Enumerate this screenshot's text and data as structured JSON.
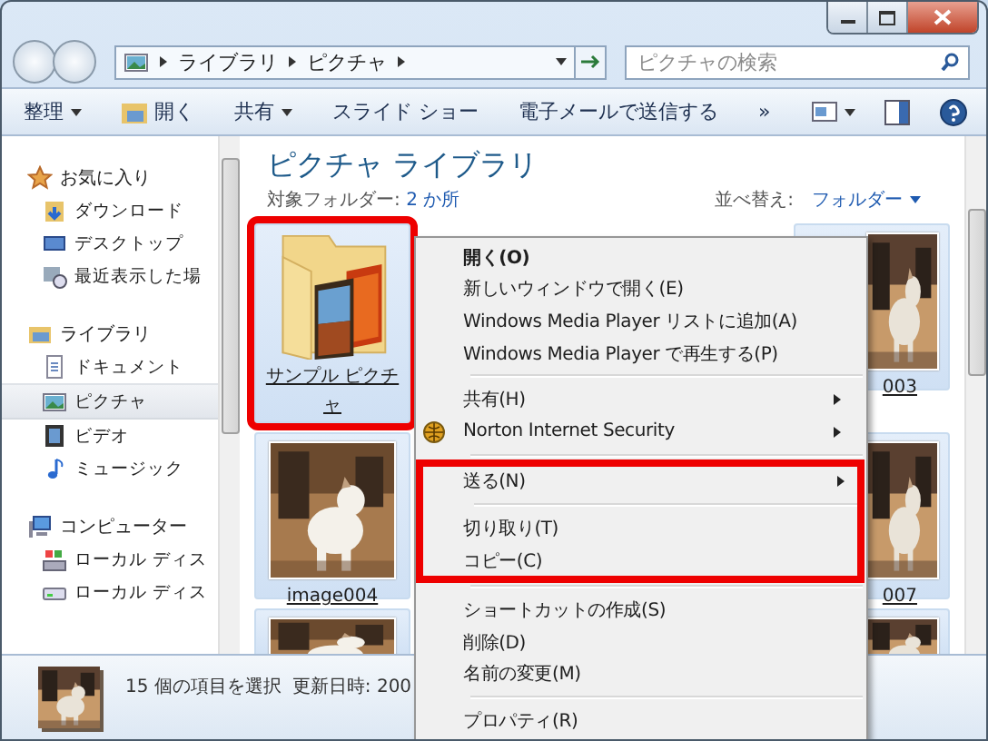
{
  "address_bar": {
    "crumbs": [
      "ライブラリ",
      "ピクチャ"
    ]
  },
  "search": {
    "placeholder": "ピクチャの検索"
  },
  "toolbar": {
    "buttons": [
      {
        "label": "整理",
        "kind": "menu"
      },
      {
        "label": "開く",
        "kind": "open"
      },
      {
        "label": "共有",
        "kind": "menu"
      },
      {
        "label": "スライド ショー",
        "kind": "plain"
      },
      {
        "label": "電子メールで送信する",
        "kind": "plain"
      },
      {
        "label": "»",
        "kind": "plain"
      }
    ]
  },
  "sidebar": {
    "groups": [
      {
        "label": "お気に入り",
        "kind": "star",
        "items": [
          {
            "label": "ダウンロード",
            "kind": "download",
            "selected": false
          },
          {
            "label": "デスクトップ",
            "kind": "desktop",
            "selected": false
          },
          {
            "label": "最近表示した場",
            "kind": "recent",
            "selected": false
          }
        ]
      },
      {
        "label": "ライブラリ",
        "kind": "library",
        "items": [
          {
            "label": "ドキュメント",
            "kind": "document",
            "selected": false
          },
          {
            "label": "ピクチャ",
            "kind": "pictures",
            "selected": true
          },
          {
            "label": "ビデオ",
            "kind": "video",
            "selected": false
          },
          {
            "label": "ミュージック",
            "kind": "music",
            "selected": false
          }
        ]
      },
      {
        "label": "コンピューター",
        "kind": "computer",
        "items": [
          {
            "label": "ローカル ディス",
            "kind": "system-disk",
            "selected": false
          },
          {
            "label": "ローカル ディス",
            "kind": "disk",
            "selected": false
          }
        ]
      }
    ]
  },
  "library": {
    "title": "ピクチャ ライブラリ",
    "folders_label": "対象フォルダー:",
    "folders_link": "2 か所",
    "sort_label": "並べ替え:",
    "sort_value": "フォルダー"
  },
  "items": [
    {
      "kind": "folder",
      "label": "サンプル ピクチャ",
      "selected": true,
      "highlighted": true
    },
    {
      "kind": "picture",
      "label": "003",
      "selected": true,
      "highlighted": false
    },
    {
      "kind": "picture",
      "label": "image004",
      "selected": true,
      "highlighted": false
    },
    {
      "kind": "picture",
      "label": "007",
      "selected": true,
      "highlighted": false
    },
    {
      "kind": "picture",
      "selected": true,
      "highlighted": false
    },
    {
      "kind": "picture",
      "selected": true,
      "highlighted": false
    }
  ],
  "context_menu": [
    {
      "kind": "item",
      "label": "開く(O)",
      "default": true,
      "submenu": false,
      "highlighted": false
    },
    {
      "kind": "item",
      "label": "新しいウィンドウで開く(E)",
      "default": false,
      "submenu": false,
      "highlighted": false
    },
    {
      "kind": "item",
      "label": "Windows Media Player リストに追加(A)",
      "default": false,
      "submenu": false,
      "highlighted": false
    },
    {
      "kind": "item",
      "label": "Windows Media Player で再生する(P)",
      "default": false,
      "submenu": false,
      "highlighted": false
    },
    {
      "kind": "separator"
    },
    {
      "kind": "item",
      "label": "共有(H)",
      "default": false,
      "submenu": true,
      "highlighted": false
    },
    {
      "kind": "norton",
      "label": "Norton Internet Security",
      "default": false,
      "submenu": true,
      "highlighted": false
    },
    {
      "kind": "separator"
    },
    {
      "kind": "item",
      "label": "送る(N)",
      "default": false,
      "submenu": true,
      "highlighted": true
    },
    {
      "kind": "separator"
    },
    {
      "kind": "item",
      "label": "切り取り(T)",
      "default": false,
      "submenu": false,
      "highlighted": true
    },
    {
      "kind": "item",
      "label": "コピー(C)",
      "default": false,
      "submenu": false,
      "highlighted": true
    },
    {
      "kind": "separator"
    },
    {
      "kind": "item",
      "label": "ショートカットの作成(S)",
      "default": false,
      "submenu": false,
      "highlighted": false
    },
    {
      "kind": "item",
      "label": "削除(D)",
      "default": false,
      "submenu": false,
      "highlighted": false
    },
    {
      "kind": "item",
      "label": "名前の変更(M)",
      "default": false,
      "submenu": false,
      "highlighted": false
    },
    {
      "kind": "separator"
    },
    {
      "kind": "item",
      "label": "プロパティ(R)",
      "default": false,
      "submenu": false,
      "highlighted": false
    }
  ],
  "status_bar": {
    "text": "15 個の項目を選択",
    "modified": "更新日時: 200"
  }
}
